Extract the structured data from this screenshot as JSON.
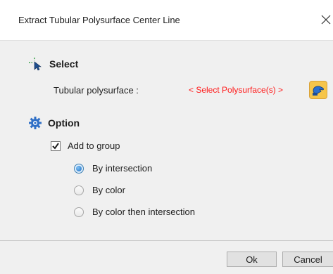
{
  "dialog": {
    "title": "Extract Tubular Polysurface Center Line",
    "close_icon": "close-icon"
  },
  "select_section": {
    "icon": "select-cursor-icon",
    "heading": "Select",
    "field_label": "Tubular polysurface :",
    "field_value": "< Select Polysurface(s) >",
    "field_value_color": "#ff1a1a",
    "pick_button_icon": "hand-pick-icon"
  },
  "option_section": {
    "icon": "gear-icon",
    "heading": "Option",
    "add_to_group": {
      "label": "Add to group",
      "checked": true
    },
    "radios": [
      {
        "label": "By intersection",
        "selected": true
      },
      {
        "label": "By color",
        "selected": false
      },
      {
        "label": "By color then intersection",
        "selected": false
      }
    ]
  },
  "buttons": {
    "ok": "Ok",
    "cancel": "Cancel"
  }
}
